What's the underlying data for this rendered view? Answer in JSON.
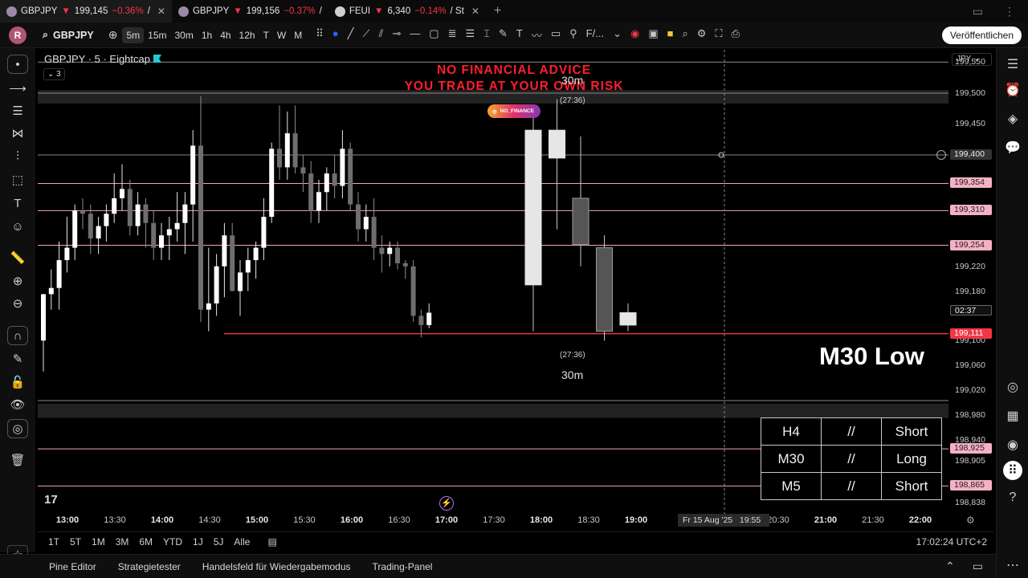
{
  "browser": {
    "tabs": [
      {
        "symbol": "GBPJPY",
        "arrow": "▼",
        "price": "199,145",
        "change": "−0.36%",
        "suffix": "/"
      },
      {
        "symbol": "GBPJPY",
        "arrow": "▼",
        "price": "199,156",
        "change": "−0.37%",
        "suffix": "/"
      },
      {
        "symbol": "FEUI",
        "arrow": "▼",
        "price": "6,340",
        "change": "−0.14%",
        "suffix": "/ St"
      }
    ]
  },
  "toolbar": {
    "avatar": "R",
    "symbol": "GBPJPY",
    "timeframes": [
      "5m",
      "15m",
      "30m",
      "1h",
      "4h",
      "12h",
      "T",
      "W",
      "M"
    ],
    "active_timeframe": "5m",
    "indicator_label": "F/...",
    "publish_label": "Veröffentlichen"
  },
  "chart": {
    "title": "GBPJPY · 5 · Eightcap",
    "legend_count": "3",
    "disclaimer_line1": "NO FINANCIAL ADVICE",
    "disclaimer_line2": "YOU TRADE AT YOUR OWN RISK",
    "instagram_handle": "NO_FINANCE",
    "label_30m_top": "30m",
    "label_timer_top": "(27:36)",
    "label_timer_bottom": "(27:36)",
    "label_30m_bottom": "30m",
    "annotation": "M30 Low",
    "signal_table": [
      [
        "H4",
        "//",
        "Short"
      ],
      [
        "M30",
        "//",
        "Long"
      ],
      [
        "M5",
        "//",
        "Short"
      ]
    ]
  },
  "price_axis": {
    "currency": "JPY",
    "labels": [
      "199,550",
      "199,500",
      "199,450",
      "199,220",
      "199,180",
      "199,100",
      "199,060",
      "199,020",
      "198,980",
      "198,940",
      "198,905",
      "198,838"
    ],
    "badges": {
      "crosshair": "199,400",
      "level1": "199,354",
      "level2": "199,310",
      "level3": "199,254",
      "countdown": "02:37",
      "current": "199,111",
      "level4": "198,925",
      "level5": "198,865"
    }
  },
  "time_axis": {
    "labels": [
      "13:00",
      "13:30",
      "14:00",
      "14:30",
      "15:00",
      "15:30",
      "16:00",
      "16:30",
      "17:00",
      "17:30",
      "18:00",
      "18:30",
      "19:00",
      "20:30",
      "21:00",
      "21:30",
      "22:00"
    ],
    "crosshair_date": "Fr 15 Aug '25",
    "crosshair_time": "19:55"
  },
  "range_bar": {
    "ranges": [
      "1T",
      "5T",
      "1M",
      "3M",
      "6M",
      "YTD",
      "1J",
      "5J",
      "Alle"
    ],
    "clock": "17:02:24 UTC+2"
  },
  "bottom_panel": {
    "tabs": [
      "Pine Editor",
      "Strategietester",
      "Handelsfeld für Wiedergabemodus",
      "Trading-Panel"
    ]
  },
  "chart_data": {
    "type": "candlestick",
    "ylim": [
      198.82,
      199.57
    ],
    "ticks": [
      199.55,
      199.5,
      199.45,
      199.22,
      199.18,
      199.1,
      199.06,
      199.02,
      198.98,
      198.94,
      198.905,
      198.838
    ],
    "horizontal_levels": {
      "pink": [
        199.354,
        199.31,
        199.254,
        198.925,
        198.865
      ],
      "red": [
        199.111
      ],
      "grey": [
        199.55,
        199.5,
        199.4,
        199.003
      ],
      "grey_zones": [
        [
          199.483,
          199.505
        ],
        [
          198.975,
          198.998
        ]
      ]
    },
    "m5_candles": [
      {
        "o": 199.1,
        "h": 199.175,
        "l": 199.05,
        "c": 199.175
      },
      {
        "o": 199.175,
        "h": 199.215,
        "l": 199.15,
        "c": 199.185
      },
      {
        "o": 199.185,
        "h": 199.26,
        "l": 199.15,
        "c": 199.23
      },
      {
        "o": 199.23,
        "h": 199.3,
        "l": 199.21,
        "c": 199.25
      },
      {
        "o": 199.25,
        "h": 199.32,
        "l": 199.23,
        "c": 199.31
      },
      {
        "o": 199.31,
        "h": 199.33,
        "l": 199.28,
        "c": 199.305
      },
      {
        "o": 199.305,
        "h": 199.32,
        "l": 199.24,
        "c": 199.265
      },
      {
        "o": 199.265,
        "h": 199.3,
        "l": 199.24,
        "c": 199.285
      },
      {
        "o": 199.285,
        "h": 199.32,
        "l": 199.26,
        "c": 199.305
      },
      {
        "o": 199.305,
        "h": 199.37,
        "l": 199.29,
        "c": 199.33
      },
      {
        "o": 199.33,
        "h": 199.385,
        "l": 199.31,
        "c": 199.345
      },
      {
        "o": 199.345,
        "h": 199.36,
        "l": 199.27,
        "c": 199.285
      },
      {
        "o": 199.285,
        "h": 199.34,
        "l": 199.27,
        "c": 199.32
      },
      {
        "o": 199.32,
        "h": 199.33,
        "l": 199.25,
        "c": 199.29
      },
      {
        "o": 199.29,
        "h": 199.31,
        "l": 199.23,
        "c": 199.25
      },
      {
        "o": 199.25,
        "h": 199.29,
        "l": 199.23,
        "c": 199.27
      },
      {
        "o": 199.27,
        "h": 199.3,
        "l": 199.23,
        "c": 199.28
      },
      {
        "o": 199.28,
        "h": 199.34,
        "l": 199.26,
        "c": 199.29
      },
      {
        "o": 199.29,
        "h": 199.34,
        "l": 199.24,
        "c": 199.32
      },
      {
        "o": 199.32,
        "h": 199.44,
        "l": 199.26,
        "c": 199.415
      },
      {
        "o": 199.415,
        "h": 199.495,
        "l": 199.13,
        "c": 199.15
      },
      {
        "o": 199.15,
        "h": 199.25,
        "l": 199.115,
        "c": 199.16
      },
      {
        "o": 199.16,
        "h": 199.24,
        "l": 199.14,
        "c": 199.22
      },
      {
        "o": 199.22,
        "h": 199.29,
        "l": 199.17,
        "c": 199.27
      },
      {
        "o": 199.27,
        "h": 199.29,
        "l": 199.18,
        "c": 199.18
      },
      {
        "o": 199.18,
        "h": 199.23,
        "l": 199.14,
        "c": 199.21
      },
      {
        "o": 199.21,
        "h": 199.25,
        "l": 199.18,
        "c": 199.23
      },
      {
        "o": 199.23,
        "h": 199.26,
        "l": 199.2,
        "c": 199.25
      },
      {
        "o": 199.25,
        "h": 199.33,
        "l": 199.23,
        "c": 199.3
      },
      {
        "o": 199.3,
        "h": 199.42,
        "l": 199.29,
        "c": 199.41
      },
      {
        "o": 199.41,
        "h": 199.48,
        "l": 199.36,
        "c": 199.38
      },
      {
        "o": 199.38,
        "h": 199.47,
        "l": 199.36,
        "c": 199.435
      },
      {
        "o": 199.435,
        "h": 199.48,
        "l": 199.37,
        "c": 199.38
      },
      {
        "o": 199.38,
        "h": 199.4,
        "l": 199.34,
        "c": 199.37
      },
      {
        "o": 199.37,
        "h": 199.39,
        "l": 199.29,
        "c": 199.31
      },
      {
        "o": 199.31,
        "h": 199.36,
        "l": 199.29,
        "c": 199.34
      },
      {
        "o": 199.34,
        "h": 199.38,
        "l": 199.31,
        "c": 199.37
      },
      {
        "o": 199.37,
        "h": 199.4,
        "l": 199.33,
        "c": 199.35
      },
      {
        "o": 199.35,
        "h": 199.44,
        "l": 199.33,
        "c": 199.41
      },
      {
        "o": 199.41,
        "h": 199.42,
        "l": 199.31,
        "c": 199.32
      },
      {
        "o": 199.32,
        "h": 199.34,
        "l": 199.26,
        "c": 199.28
      },
      {
        "o": 199.28,
        "h": 199.32,
        "l": 199.26,
        "c": 199.3
      },
      {
        "o": 199.3,
        "h": 199.33,
        "l": 199.23,
        "c": 199.25
      },
      {
        "o": 199.25,
        "h": 199.27,
        "l": 199.21,
        "c": 199.24
      },
      {
        "o": 199.24,
        "h": 199.26,
        "l": 199.22,
        "c": 199.25
      },
      {
        "o": 199.25,
        "h": 199.26,
        "l": 199.215,
        "c": 199.225
      },
      {
        "o": 199.225,
        "h": 199.23,
        "l": 199.2,
        "c": 199.22
      },
      {
        "o": 199.22,
        "h": 199.23,
        "l": 199.13,
        "c": 199.14
      },
      {
        "o": 199.14,
        "h": 199.15,
        "l": 199.105,
        "c": 199.125
      },
      {
        "o": 199.125,
        "h": 199.16,
        "l": 199.12,
        "c": 199.145
      }
    ],
    "m30_candles": [
      {
        "o": 199.19,
        "h": 199.46,
        "l": 199.115,
        "c": 199.44
      },
      {
        "o": 199.395,
        "h": 199.49,
        "l": 199.28,
        "c": 199.44
      },
      {
        "o": 199.33,
        "h": 199.43,
        "l": 199.22,
        "c": 199.255
      },
      {
        "o": 199.25,
        "h": 199.27,
        "l": 199.1,
        "c": 199.115
      },
      {
        "o": 199.125,
        "h": 199.16,
        "l": 199.115,
        "c": 199.145
      }
    ]
  }
}
